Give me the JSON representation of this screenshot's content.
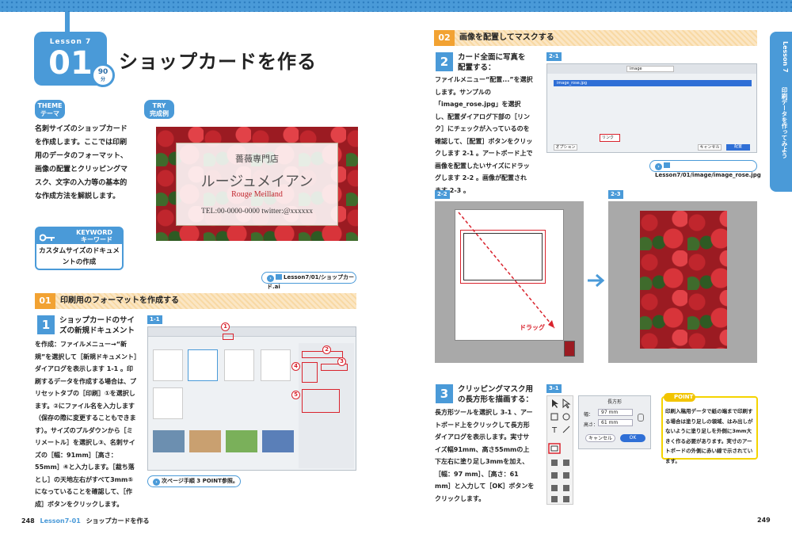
{
  "header": {
    "lesson_label": "Lesson 7",
    "lesson_number": "01",
    "time_badge": "90",
    "time_unit": "分",
    "page_title": "ショップカードを作る"
  },
  "theme": {
    "pill_en": "THEME",
    "pill_jp": "テーマ",
    "text": "名刺サイズのショップカードを作成します。ここでは印刷用のデータのフォーマット、画像の配置とクリッピングマスク、文字の入力等の基本的な作成方法を解説します。"
  },
  "try": {
    "pill_en": "TRY",
    "pill_jp": "完成例"
  },
  "keyword": {
    "label_en": "KEYWORD",
    "label_jp": "キーワード",
    "text": "カスタムサイズのドキュメントの作成"
  },
  "card": {
    "shop": "薔薇専門店",
    "name": "ルージュメイアン",
    "roman": "Rouge Meilland",
    "tel": "TEL:00-0000-0000  twitter:@xxxxxx"
  },
  "file_tags": {
    "card_file": "Lesson7/01/ショップカード.ai",
    "image_file": "Lesson7/01/image/image_rose.jpg"
  },
  "section01": {
    "num": "01",
    "label": "印刷用のフォーマットを作成する",
    "step_num": "1",
    "step_head": "ショップカードのサイズの新規ドキュメント",
    "body": "を作成：ファイルメニュー→“新規”を選択して［新規ドキュメント］ダイアログを表示します 1-1 。印刷するデータを作成する場合は、プリセットタブの［印刷］①を選択します。②にファイル名を入力します（保存の際に変更することもできます）。サイズのプルダウンから［ミリメートル］を選択し③、名刺サイズの［幅：91mm］［高さ：55mm］④と入力します。［裁ち落とし］の天地左右がすべて3mm⑤になっていることを確認して、［作成］ボタンをクリックします。",
    "fig": "1-1",
    "next_ref": "次ページ手順 3 POINT参照。"
  },
  "section02": {
    "num": "02",
    "label": "画像を配置してマスクする",
    "step2_num": "2",
    "step2_head": "カード全面に写真を配置する：",
    "step2_body": "ファイルメニュー“配置...”を選択します。サンプルの「image_rose.jpg」を選択し、配置ダイアログ下部の［リンク］にチェックが入っているのを確認して、［配置］ボタンをクリックします 2-1 。アートボード上で画像を配置したいサイズにドラッグします 2-2 。画像が配置されます 2-3 。",
    "fig21": "2-1",
    "fig22": "2-2",
    "fig23": "2-3",
    "drag_label": "ドラッグ",
    "step3_num": "3",
    "step3_head": "クリッピングマスク用の長方形を描画する：",
    "step3_body": "長方形ツールを選択し 3-1 、アートボード上をクリックして長方形ダイアログを表示します。実寸サイズ幅91mm、高さ55mmの上下左右に塗り足し3mmを加え、［幅：97 mm］、［高さ：61 mm］と入力して［OK］ボタンをクリックします。",
    "fig31": "3-1"
  },
  "dialog_rect": {
    "title": "長方形",
    "width_label": "幅：",
    "width_val": "97 mm",
    "height_label": "高さ：",
    "height_val": "61 mm",
    "cancel": "キャンセル",
    "ok": "OK"
  },
  "file_dialog": {
    "folder": "image",
    "file": "image_rose.jpg",
    "link": "リンク",
    "template": "テンプレート",
    "replace": "置換",
    "options": "オプション",
    "cancel": "キャンセル",
    "place": "配置"
  },
  "point": {
    "label": "POINT",
    "text": "印刷入稿用データで紙の端まで印刷する場合は塗り足しの領域、はみ出しがないように塗り足しを外側に3mm大きく作る必要があります。実寸のアートボードの外側に赤い線で示されています。"
  },
  "side": {
    "title": "Lesson 7",
    "subtitle": "印刷データを作ってみよう"
  },
  "footer": {
    "left_page": "248",
    "left_lesson": "Lesson7-01",
    "left_title": "ショップカードを作る",
    "right_page": "249"
  },
  "colors": {
    "accent": "#4a9ad8",
    "orange": "#f2a232",
    "red": "#d9232d",
    "yellow": "#f5d400"
  }
}
